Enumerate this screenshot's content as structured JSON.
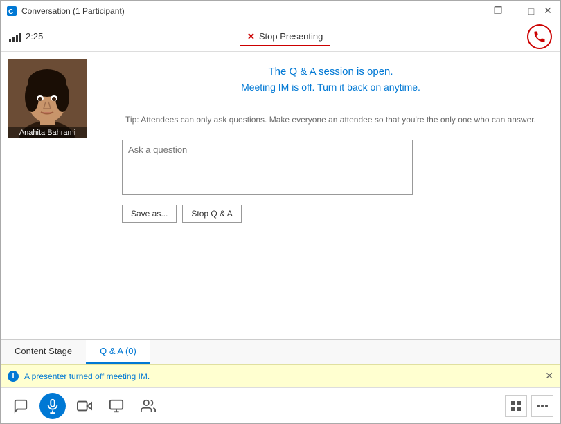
{
  "window": {
    "title": "Conversation (1 Participant)"
  },
  "titlebar": {
    "controls": {
      "restore": "❐",
      "minimize": "—",
      "maximize": "□",
      "close": "✕"
    }
  },
  "topbar": {
    "time": "2:25",
    "stop_presenting_label": "Stop Presenting",
    "end_call_symbol": "📞"
  },
  "avatar": {
    "name": "Anahita Bahrami"
  },
  "content": {
    "session_open": "The Q & A session is open.",
    "im_off": "Meeting IM is off. Turn it back on anytime.",
    "tip": "Tip: Attendees can only ask questions. Make everyone an attendee so that you're the only one who can answer.",
    "ask_placeholder": "Ask a question"
  },
  "buttons": {
    "save_as": "Save as...",
    "stop_qa": "Stop Q & A"
  },
  "tabs": [
    {
      "label": "Content Stage",
      "active": false
    },
    {
      "label": "Q & A (0)",
      "active": true
    }
  ],
  "notification": {
    "text": "A presenter turned off meeting IM.",
    "close": "✕"
  },
  "toolbar": {
    "chat_icon": "💬",
    "call_icon": "🎤",
    "video_icon": "📷",
    "screen_icon": "🖥",
    "people_icon": "👥",
    "grid_icon": "⊞",
    "more_icon": "•••"
  }
}
